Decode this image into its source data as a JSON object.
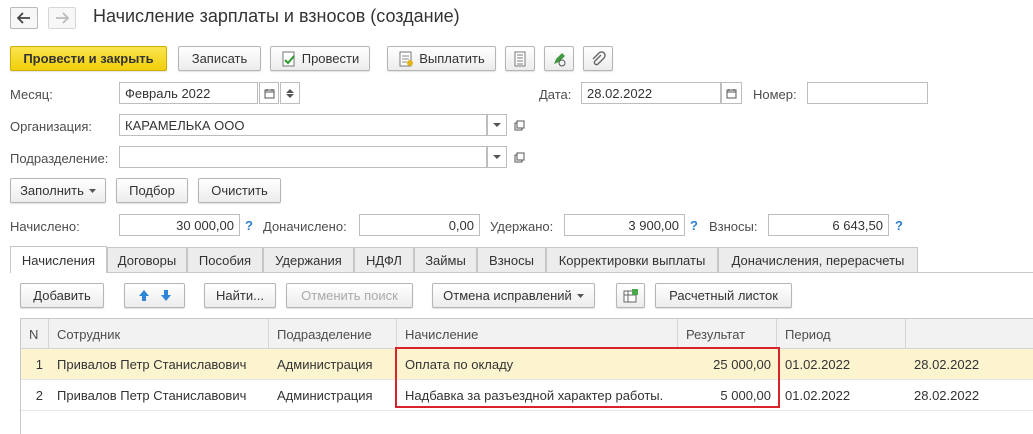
{
  "window": {
    "title": "Начисление зарплаты и взносов (создание)"
  },
  "toolbar": {
    "post_and_close": "Провести и закрыть",
    "save": "Записать",
    "post": "Провести",
    "pay": "Выплатить"
  },
  "form": {
    "month_label": "Месяц:",
    "month_value": "Февраль 2022",
    "date_label": "Дата:",
    "date_value": "28.02.2022",
    "number_label": "Номер:",
    "number_value": "",
    "org_label": "Организация:",
    "org_value": "КАРАМЕЛЬКА ООО",
    "dept_label": "Подразделение:",
    "dept_value": ""
  },
  "actions": {
    "fill": "Заполнить",
    "select": "Подбор",
    "clear": "Очистить"
  },
  "totals": {
    "accrued_label": "Начислено:",
    "accrued_value": "30 000,00",
    "extra_label": "Доначислено:",
    "extra_value": "0,00",
    "withheld_label": "Удержано:",
    "withheld_value": "3 900,00",
    "contrib_label": "Взносы:",
    "contrib_value": "6 643,50",
    "help": "?"
  },
  "tabs": [
    {
      "label": "Начисления"
    },
    {
      "label": "Договоры"
    },
    {
      "label": "Пособия"
    },
    {
      "label": "Удержания"
    },
    {
      "label": "НДФЛ"
    },
    {
      "label": "Займы"
    },
    {
      "label": "Взносы"
    },
    {
      "label": "Корректировки выплаты"
    },
    {
      "label": "Доначисления, перерасчеты"
    }
  ],
  "grid_toolbar": {
    "add": "Добавить",
    "find": "Найти...",
    "cancel_search": "Отменить поиск",
    "cancel_corrections": "Отмена исправлений",
    "payslip": "Расчетный листок"
  },
  "table": {
    "columns": [
      "N",
      "Сотрудник",
      "Подразделение",
      "Начисление",
      "Результат",
      "Период",
      ""
    ],
    "rows": [
      {
        "n": "1",
        "employee": "Привалов Петр Станиславович",
        "dept": "Администрация",
        "accrual": "Оплата по окладу",
        "result": "25 000,00",
        "period_from": "01.02.2022",
        "period_to": "28.02.2022"
      },
      {
        "n": "2",
        "employee": "Привалов Петр Станиславович",
        "dept": "Администрация",
        "accrual": "Надбавка за разъездной характер работы.",
        "result": "5 000,00",
        "period_from": "01.02.2022",
        "period_to": "28.02.2022"
      }
    ]
  },
  "colors": {
    "primary_button": "#f2d21b",
    "highlight_border": "#d8232a",
    "selected_row": "#fbf4cf",
    "help_mark": "#2f7fd0"
  }
}
